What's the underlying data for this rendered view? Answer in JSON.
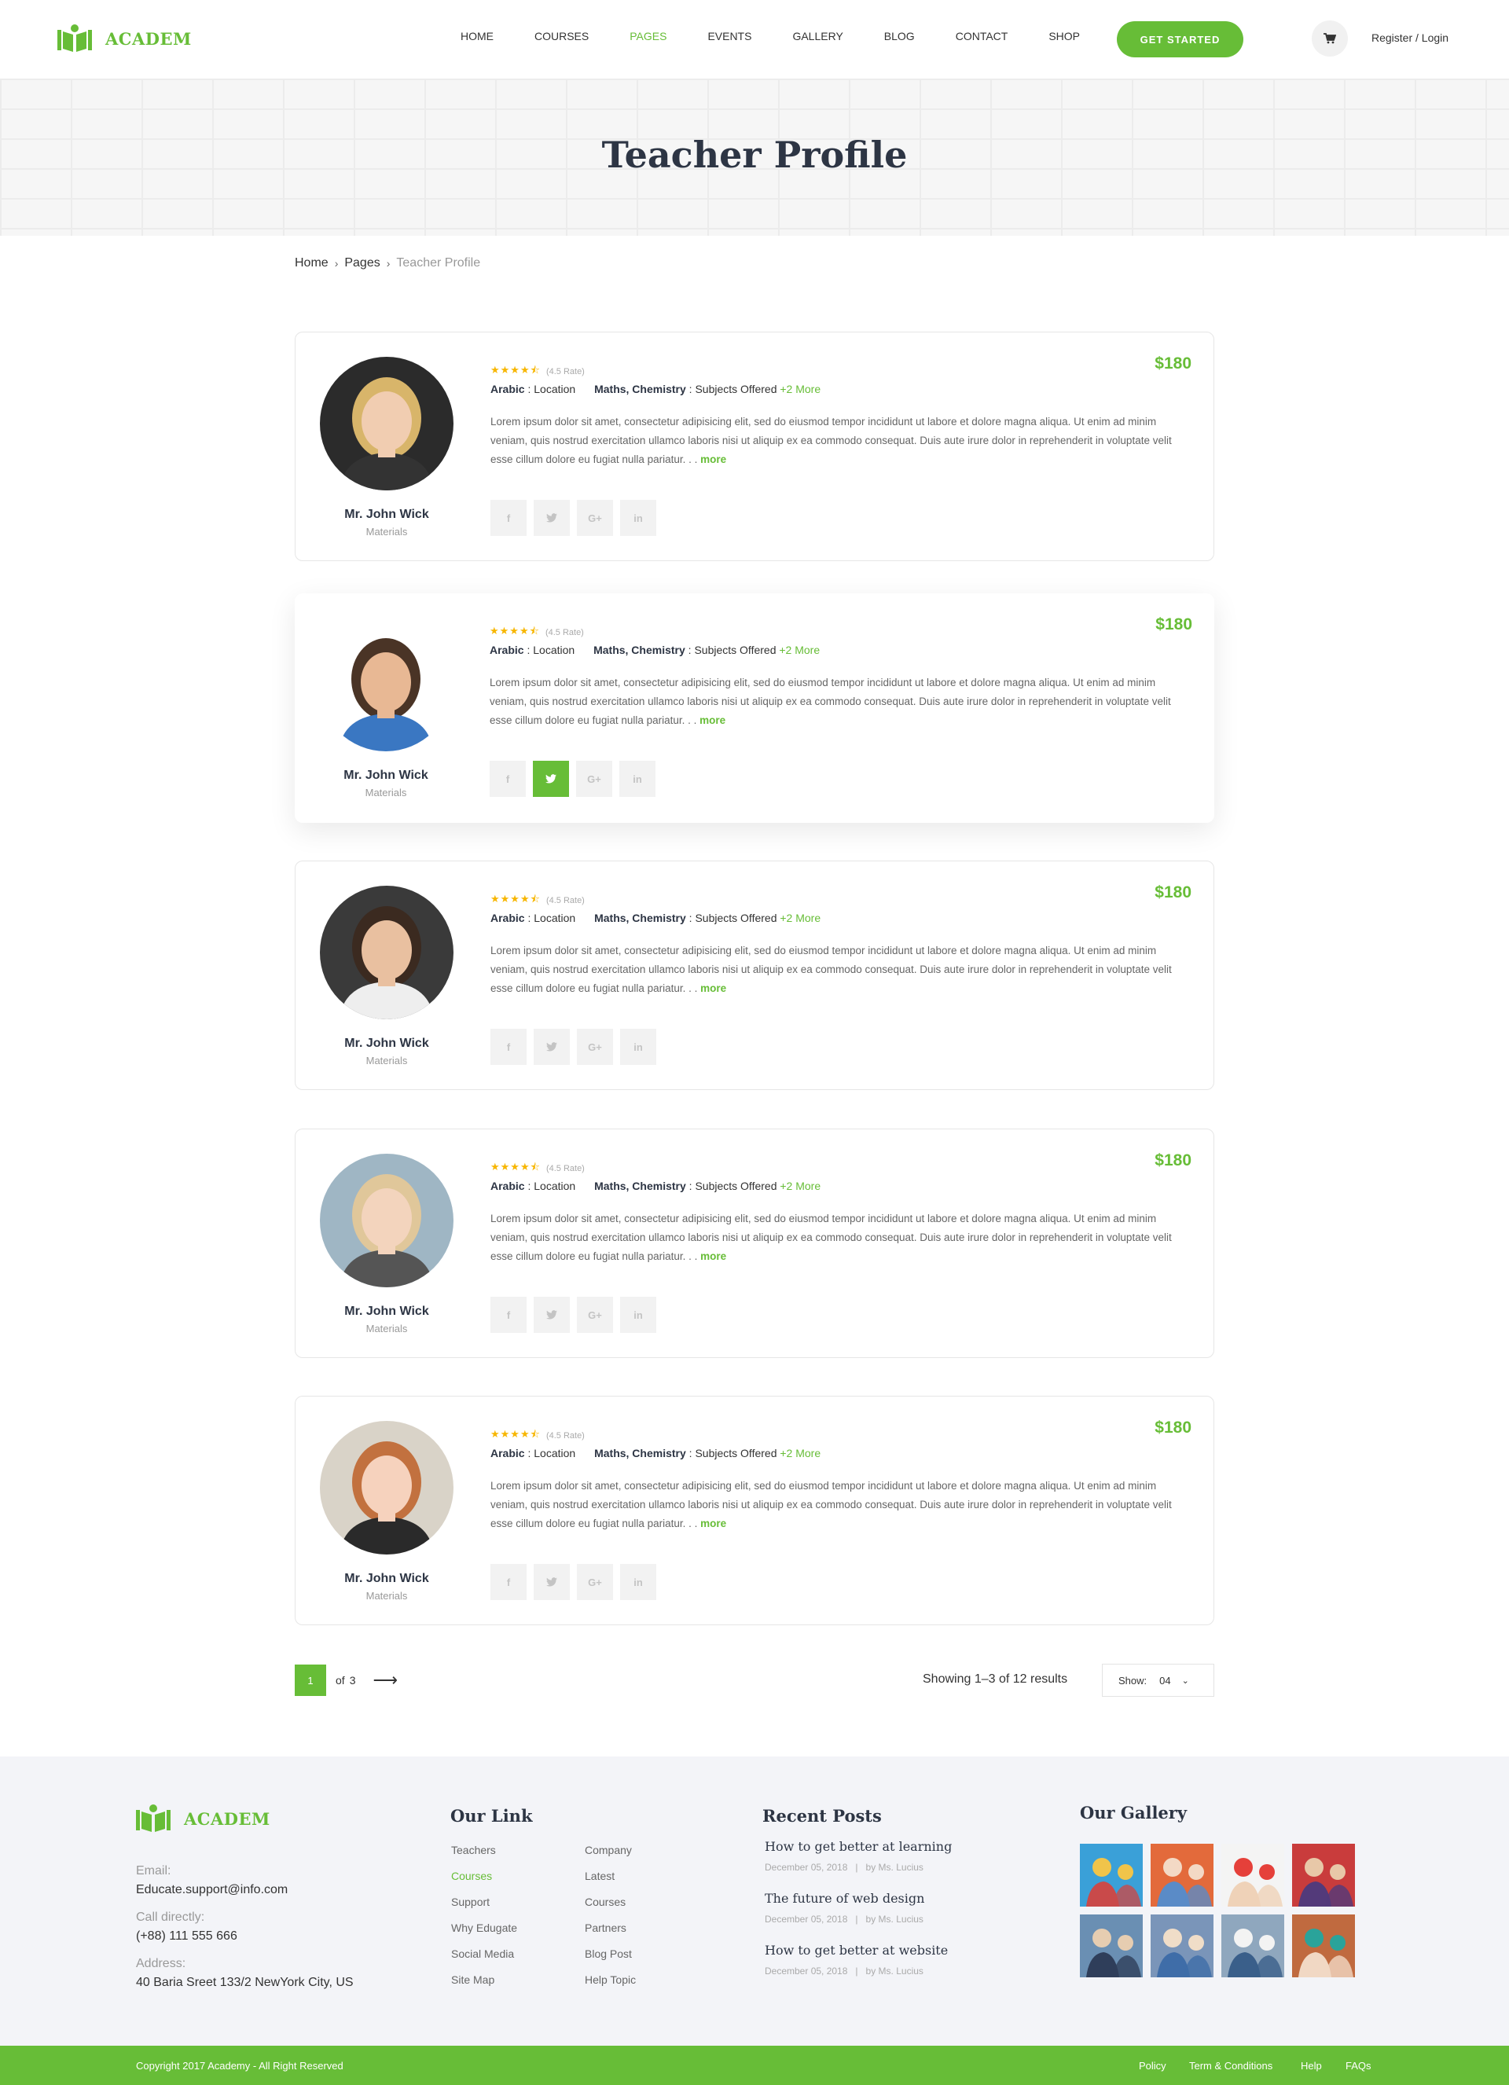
{
  "brand": {
    "name": "ACADEM",
    "color": "#67bd37"
  },
  "nav": {
    "items": [
      "HOME",
      "COURSES",
      "PAGES",
      "EVENTS",
      "GALLERY",
      "BLOG",
      "CONTACT",
      "SHOP"
    ],
    "active": "PAGES",
    "cta": "GET STARTED",
    "cart_icon": "cart-icon",
    "register": "Register / Login"
  },
  "hero": {
    "title": "Teacher Profile"
  },
  "breadcrumb": {
    "home": "Home",
    "pages": "Pages",
    "current": "Teacher Profile"
  },
  "teachers": [
    {
      "name": "Mr. John Wick",
      "subject": "Materials",
      "stars": 4.5,
      "rate": "(4.5 Rate)",
      "price": "$180",
      "location_label": "Arabic",
      "location_suffix": ": Location",
      "subjects": "Maths, Chemistry",
      "subjects_suffix": ": Subjects Offered",
      "more_subjects": "+2 More",
      "desc": "Lorem ipsum dolor sit amet, consectetur adipisicing elit, sed do eiusmod tempor incididunt ut labore et dolore magna aliqua. Ut enim ad minim veniam, quis nostrud exercitation ullamco laboris nisi ut aliquip ex ea commodo consequat. Duis aute irure dolor in reprehenderit in voluptate velit esse cillum dolore eu fugiat nulla pariatur. . .",
      "more": "more"
    },
    {
      "name": "Mr. John Wick",
      "subject": "Materials",
      "stars": 4.5,
      "rate": "(4.5 Rate)",
      "price": "$180",
      "location_label": "Arabic",
      "location_suffix": ": Location",
      "subjects": "Maths, Chemistry",
      "subjects_suffix": ": Subjects Offered",
      "more_subjects": "+2 More",
      "desc": "Lorem ipsum dolor sit amet, consectetur adipisicing elit, sed do eiusmod tempor incididunt ut labore et dolore magna aliqua. Ut enim ad minim veniam, quis nostrud exercitation ullamco laboris nisi ut aliquip ex ea commodo consequat. Duis aute irure dolor in reprehenderit in voluptate velit esse cillum dolore eu fugiat nulla pariatur. . .",
      "more": "more"
    },
    {
      "name": "Mr. John Wick",
      "subject": "Materials",
      "stars": 4.5,
      "rate": "(4.5 Rate)",
      "price": "$180",
      "location_label": "Arabic",
      "location_suffix": ": Location",
      "subjects": "Maths, Chemistry",
      "subjects_suffix": ": Subjects Offered",
      "more_subjects": "+2 More",
      "desc": "Lorem ipsum dolor sit amet, consectetur adipisicing elit, sed do eiusmod tempor incididunt ut labore et dolore magna aliqua. Ut enim ad minim veniam, quis nostrud exercitation ullamco laboris nisi ut aliquip ex ea commodo consequat. Duis aute irure dolor in reprehenderit in voluptate velit esse cillum dolore eu fugiat nulla pariatur. . .",
      "more": "more"
    },
    {
      "name": "Mr. John Wick",
      "subject": "Materials",
      "stars": 4.5,
      "rate": "(4.5 Rate)",
      "price": "$180",
      "location_label": "Arabic",
      "location_suffix": ": Location",
      "subjects": "Maths, Chemistry",
      "subjects_suffix": ": Subjects Offered",
      "more_subjects": "+2 More",
      "desc": "Lorem ipsum dolor sit amet, consectetur adipisicing elit, sed do eiusmod tempor incididunt ut labore et dolore magna aliqua. Ut enim ad minim veniam, quis nostrud exercitation ullamco laboris nisi ut aliquip ex ea commodo consequat. Duis aute irure dolor in reprehenderit in voluptate velit esse cillum dolore eu fugiat nulla pariatur. . .",
      "more": "more"
    },
    {
      "name": "Mr. John Wick",
      "subject": "Materials",
      "stars": 4.5,
      "rate": "(4.5 Rate)",
      "price": "$180",
      "location_label": "Arabic",
      "location_suffix": ": Location",
      "subjects": "Maths, Chemistry",
      "subjects_suffix": ": Subjects Offered",
      "more_subjects": "+2 More",
      "desc": "Lorem ipsum dolor sit amet, consectetur adipisicing elit, sed do eiusmod tempor incididunt ut labore et dolore magna aliqua. Ut enim ad minim veniam, quis nostrud exercitation ullamco laboris nisi ut aliquip ex ea commodo consequat. Duis aute irure dolor in reprehenderit in voluptate velit esse cillum dolore eu fugiat nulla pariatur. . .",
      "more": "more"
    }
  ],
  "socials": {
    "facebook": "f",
    "twitter": "twitter-icon",
    "google": "G+",
    "linkedin": "in",
    "active_card": 2,
    "active_icon": "twitter"
  },
  "pagination": {
    "current": "1",
    "of": "of",
    "total": "3",
    "results": "Showing 1–3 of 12 results",
    "show_label": "Show:",
    "show_value": "04"
  },
  "footer": {
    "brand": "ACADEM",
    "email_label": "Email:",
    "email": "Educate.support@info.com",
    "call_label": "Call directly:",
    "call": "(+88) 111 555 666",
    "address_label": "Address:",
    "address": "40 Baria Sreet 133/2 NewYork City, US",
    "links_title": "Our Link",
    "links_col1": [
      "Teachers",
      "Courses",
      "Support",
      "Why Edugate",
      "Social Media",
      "Site Map"
    ],
    "links_col2": [
      "Company",
      "Latest",
      "Courses",
      "Partners",
      "Blog Post",
      "Help Topic"
    ],
    "links_active": "Courses",
    "posts_title": "Recent Posts",
    "posts": [
      {
        "title": "How to get better at learning",
        "date": "December 05, 2018",
        "by": "by Ms. Lucius"
      },
      {
        "title": "The future of web design",
        "date": "December 05, 2018",
        "by": "by Ms. Lucius"
      },
      {
        "title": "How to get better at website",
        "date": "December 05, 2018",
        "by": "by Ms. Lucius"
      }
    ],
    "gallery_title": "Our Gallery",
    "copyright": "Copyright 2017 Academy - All Right Reserved",
    "bottom_links": [
      "Policy",
      "Term & Conditions",
      "Help",
      "FAQs"
    ]
  }
}
